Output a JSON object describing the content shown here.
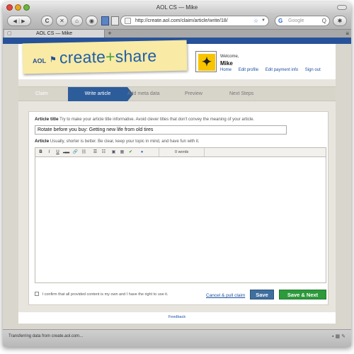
{
  "window": {
    "title": "AOL CS — Mike"
  },
  "toolbar": {
    "back_glyph": "◀",
    "forward_glyph": "▶",
    "reload_glyph": "C",
    "stop_glyph": "✕",
    "home_glyph": "⌂",
    "url": "http://create.aol.com/claim/article/write/18/",
    "search_placeholder": "Google",
    "star_glyph": "☆",
    "dropdown_glyph": "▼",
    "search_glyph": "Q"
  },
  "tabbar": {
    "active_tab": "AOL CS — Mike",
    "new_tab_glyph": "+",
    "close_glyph": "×"
  },
  "header": {
    "aol_mark": "AOL",
    "brand_part1": "create",
    "brand_plus": "+",
    "brand_part2": "share",
    "welcome": "Welcome,",
    "username": "Mike",
    "links": [
      "Home",
      "Edit profile",
      "Edit payment info",
      "Sign out"
    ]
  },
  "steps": [
    "Claim",
    "Write article",
    "Add meta data",
    "Preview",
    "Next Steps"
  ],
  "active_step": 1,
  "form": {
    "title_label": "Article title",
    "title_hint": "Try to make your article title informative. Avoid clever titles that don't convey the meaning of your article.",
    "title_value": "Rotate before you buy: Getting new life from old tires",
    "article_label": "Article",
    "article_hint": "Usually, shorter is better. Be clear, keep your topic in mind, and have fun with it.",
    "word_count": "0 words",
    "confirm_text": "I confirm that all provided content is my own and I have the right to use it.",
    "cancel_link": "Cancel & pull claim",
    "save_button": "Save",
    "save_next_button": "Save & Next"
  },
  "editor_tools": [
    "B",
    "I",
    "U",
    "ABC"
  ],
  "footer": {
    "feedback": "Feedback"
  },
  "status": {
    "text": "Transferring data from create.aol.com..."
  },
  "colors": {
    "aol_blue": "#27529a",
    "active_step": "#2d5c9b",
    "save_blue": "#3f6f9e",
    "save_next_green": "#2d9a3b"
  }
}
